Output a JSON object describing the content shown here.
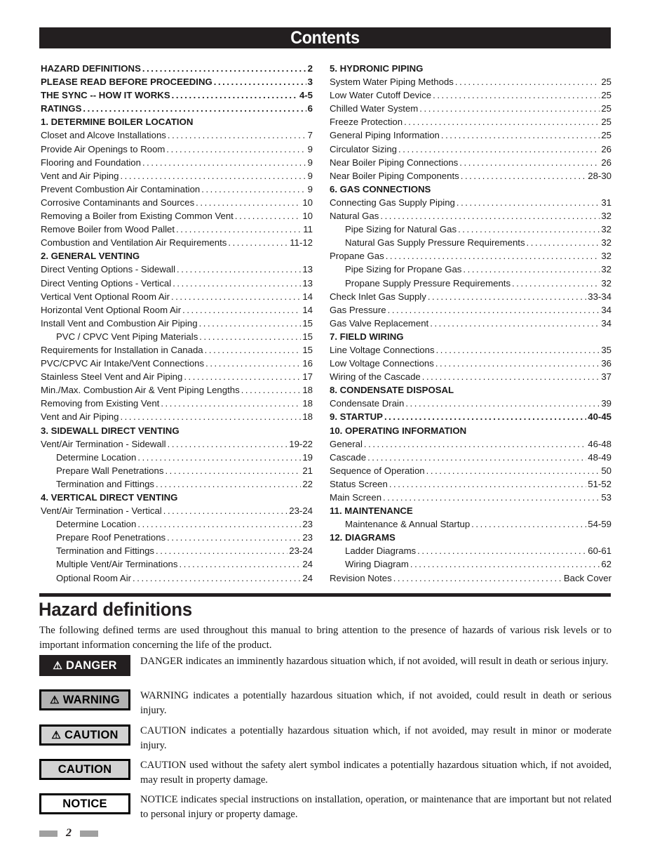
{
  "header": {
    "title": "Contents"
  },
  "toc": {
    "left_column": [
      {
        "label": "HAZARD DEFINITIONS",
        "page": "2",
        "style": "head",
        "indent": 0
      },
      {
        "label": "PLEASE READ BEFORE PROCEEDING",
        "page": "3",
        "style": "head",
        "indent": 0
      },
      {
        "label": "THE SYNC -- HOW IT WORKS",
        "page": "4-5",
        "style": "head",
        "indent": 0
      },
      {
        "label": "RATINGS",
        "page": "6",
        "style": "head",
        "indent": 0
      },
      {
        "label": "1.  DETERMINE BOILER LOCATION",
        "page": "",
        "style": "head",
        "indent": 0
      },
      {
        "label": "Closet and Alcove Installations",
        "page": "7",
        "style": "item",
        "indent": 0
      },
      {
        "label": "Provide Air Openings to Room",
        "page": "9",
        "style": "item",
        "indent": 0
      },
      {
        "label": "Flooring and Foundation",
        "page": "9",
        "style": "item",
        "indent": 0
      },
      {
        "label": "Vent and Air Piping",
        "page": "9",
        "style": "item",
        "indent": 0
      },
      {
        "label": "Prevent Combustion Air Contamination",
        "page": "9",
        "style": "item",
        "indent": 0
      },
      {
        "label": "Corrosive Contaminants and Sources",
        "page": "10",
        "style": "item",
        "indent": 0
      },
      {
        "label": "Removing a Boiler from Existing Common Vent",
        "page": "10",
        "style": "item",
        "indent": 0
      },
      {
        "label": "Remove Boiler from Wood Pallet",
        "page": "11",
        "style": "item",
        "indent": 0
      },
      {
        "label": "Combustion and Ventilation Air Requirements",
        "page": "11-12",
        "style": "item",
        "indent": 0
      },
      {
        "label": "2.  GENERAL VENTING",
        "page": "",
        "style": "head",
        "indent": 0
      },
      {
        "label": "Direct Venting Options - Sidewall",
        "page": "13",
        "style": "item",
        "indent": 0
      },
      {
        "label": "Direct Venting Options - Vertical",
        "page": "13",
        "style": "item",
        "indent": 0
      },
      {
        "label": "Vertical Vent Optional Room Air",
        "page": "14",
        "style": "item",
        "indent": 0
      },
      {
        "label": "Horizontal Vent Optional Room Air",
        "page": "14",
        "style": "item",
        "indent": 0
      },
      {
        "label": "Install Vent and Combustion Air Piping",
        "page": "15",
        "style": "item",
        "indent": 0
      },
      {
        "label": "PVC / CPVC Vent Piping Materials",
        "page": "15",
        "style": "item",
        "indent": 1
      },
      {
        "label": "Requirements for Installation in Canada",
        "page": "15",
        "style": "item",
        "indent": 0
      },
      {
        "label": "PVC/CPVC Air Intake/Vent Connections",
        "page": "16",
        "style": "item",
        "indent": 0
      },
      {
        "label": "Stainless Steel Vent and Air Piping",
        "page": "17",
        "style": "item",
        "indent": 0
      },
      {
        "label": "Min./Max. Combustion Air & Vent Piping Lengths",
        "page": "18",
        "style": "item",
        "indent": 0
      },
      {
        "label": "Removing from Existing Vent",
        "page": "18",
        "style": "item",
        "indent": 0
      },
      {
        "label": "Vent and Air Piping",
        "page": "18",
        "style": "item",
        "indent": 0
      },
      {
        "label": "3.  SIDEWALL DIRECT VENTING",
        "page": "",
        "style": "head",
        "indent": 0
      },
      {
        "label": "Vent/Air Termination - Sidewall",
        "page": "19-22",
        "style": "item",
        "indent": 0
      },
      {
        "label": "Determine Location",
        "page": "19",
        "style": "item",
        "indent": 1
      },
      {
        "label": "Prepare Wall Penetrations",
        "page": "21",
        "style": "item",
        "indent": 1
      },
      {
        "label": "Termination and Fittings",
        "page": "22",
        "style": "item",
        "indent": 1
      },
      {
        "label": "4.  VERTICAL DIRECT VENTING",
        "page": "",
        "style": "head",
        "indent": 0
      },
      {
        "label": "Vent/Air Termination - Vertical",
        "page": "23-24",
        "style": "item",
        "indent": 0
      },
      {
        "label": "Determine Location",
        "page": "23",
        "style": "item",
        "indent": 1
      },
      {
        "label": "Prepare Roof Penetrations",
        "page": "23",
        "style": "item",
        "indent": 1
      },
      {
        "label": "Termination and Fittings",
        "page": "23-24",
        "style": "item",
        "indent": 1
      },
      {
        "label": "Multiple Vent/Air Terminations",
        "page": "24",
        "style": "item",
        "indent": 1
      },
      {
        "label": "Optional Room Air",
        "page": "24",
        "style": "item",
        "indent": 1
      }
    ],
    "right_column": [
      {
        "label": "5.  HYDRONIC PIPING",
        "page": "",
        "style": "head",
        "indent": 0
      },
      {
        "label": "System Water Piping Methods",
        "page": "25",
        "style": "item",
        "indent": 0
      },
      {
        "label": "Low Water Cutoff Device",
        "page": "25",
        "style": "item",
        "indent": 0
      },
      {
        "label": "Chilled Water System",
        "page": "25",
        "style": "item",
        "indent": 0
      },
      {
        "label": "Freeze Protection",
        "page": "25",
        "style": "item",
        "indent": 0
      },
      {
        "label": "General Piping Information",
        "page": "25",
        "style": "item",
        "indent": 0
      },
      {
        "label": "Circulator Sizing",
        "page": "26",
        "style": "item",
        "indent": 0
      },
      {
        "label": "Near Boiler Piping Connections",
        "page": "26",
        "style": "item",
        "indent": 0
      },
      {
        "label": "Near Boiler Piping Components",
        "page": "28-30",
        "style": "item",
        "indent": 0
      },
      {
        "label": "6.  GAS CONNECTIONS",
        "page": "",
        "style": "head",
        "indent": 0
      },
      {
        "label": "Connecting Gas Supply Piping",
        "page": "31",
        "style": "item",
        "indent": 0
      },
      {
        "label": "Natural Gas",
        "page": "32",
        "style": "item",
        "indent": 0
      },
      {
        "label": "Pipe Sizing for Natural Gas",
        "page": "32",
        "style": "item",
        "indent": 1
      },
      {
        "label": "Natural Gas Supply Pressure Requirements",
        "page": "32",
        "style": "item",
        "indent": 1
      },
      {
        "label": "Propane Gas",
        "page": "32",
        "style": "item",
        "indent": 0
      },
      {
        "label": "Pipe Sizing for Propane Gas",
        "page": "32",
        "style": "item",
        "indent": 1
      },
      {
        "label": "Propane Supply Pressure Requirements",
        "page": "32",
        "style": "item",
        "indent": 1
      },
      {
        "label": "Check Inlet Gas Supply",
        "page": "33-34",
        "style": "item",
        "indent": 0
      },
      {
        "label": "Gas Pressure",
        "page": "34",
        "style": "item",
        "indent": 0
      },
      {
        "label": "Gas Valve Replacement",
        "page": "34",
        "style": "item",
        "indent": 0
      },
      {
        "label": "7.  FIELD WIRING",
        "page": "",
        "style": "head",
        "indent": 0
      },
      {
        "label": "Line Voltage Connections",
        "page": "35",
        "style": "item",
        "indent": 0
      },
      {
        "label": "Low Voltage Connections",
        "page": "36",
        "style": "item",
        "indent": 0
      },
      {
        "label": "Wiring of the Cascade",
        "page": "37",
        "style": "item",
        "indent": 0
      },
      {
        "label": "8.  CONDENSATE DISPOSAL",
        "page": "",
        "style": "head",
        "indent": 0
      },
      {
        "label": "Condensate Drain",
        "page": "39",
        "style": "item",
        "indent": 0
      },
      {
        "label": "9. STARTUP",
        "page": "40-45",
        "style": "head",
        "indent": 0
      },
      {
        "label": "10. OPERATING INFORMATION",
        "page": "",
        "style": "head",
        "indent": 0
      },
      {
        "label": "General",
        "page": "46-48",
        "style": "item",
        "indent": 0
      },
      {
        "label": "Cascade",
        "page": "48-49",
        "style": "item",
        "indent": 0
      },
      {
        "label": "Sequence of Operation",
        "page": "50",
        "style": "item",
        "indent": 0
      },
      {
        "label": "Status Screen",
        "page": "51-52",
        "style": "item",
        "indent": 0
      },
      {
        "label": "Main Screen",
        "page": "53",
        "style": "item",
        "indent": 0
      },
      {
        "label": "11. MAINTENANCE",
        "page": "",
        "style": "head",
        "indent": 0
      },
      {
        "label": "Maintenance & Annual Startup",
        "page": "54-59",
        "style": "item",
        "indent": 1
      },
      {
        "label": "12. DIAGRAMS",
        "page": "",
        "style": "head",
        "indent": 0
      },
      {
        "label": "Ladder Diagrams",
        "page": "60-61",
        "style": "item",
        "indent": 1
      },
      {
        "label": "Wiring Diagram",
        "page": "62",
        "style": "item",
        "indent": 1
      },
      {
        "label": "Revision Notes",
        "page": "Back Cover",
        "style": "item",
        "indent": 0
      }
    ]
  },
  "hazard": {
    "title": "Hazard definitions",
    "intro": "The following defined terms are used throughout this manual to bring attention to the presence of hazards of various risk levels or to important information concerning the life of the product.",
    "items": [
      {
        "label": "DANGER",
        "symbol": "⚠",
        "has_symbol": true,
        "box_style": "danger",
        "bg": "#231f20",
        "fg": "#ffffff",
        "text": "DANGER indicates an imminently hazardous situation which, if not avoided, will result in death or serious injury."
      },
      {
        "label": "WARNING",
        "symbol": "⚠",
        "has_symbol": true,
        "box_style": "warning",
        "bg": "#b2b2b2",
        "fg": "#000000",
        "text": "WARNING indicates a potentially hazardous situation which, if not avoided, could result in death or serious injury."
      },
      {
        "label": "CAUTION",
        "symbol": "⚠",
        "has_symbol": true,
        "box_style": "caution",
        "bg": "#d2d2d2",
        "fg": "#000000",
        "text": "CAUTION indicates a potentially hazardous situation which, if not avoided, may result in minor or moderate injury."
      },
      {
        "label": "CAUTION",
        "symbol": "",
        "has_symbol": false,
        "box_style": "caution-plain",
        "bg": "#d2d2d2",
        "fg": "#000000",
        "text": "CAUTION used without the safety alert symbol indicates a potentially hazardous situation which, if not avoided, may result in property damage."
      },
      {
        "label": "NOTICE",
        "symbol": "",
        "has_symbol": false,
        "box_style": "notice",
        "bg": "#ffffff",
        "fg": "#000000",
        "text": "NOTICE indicates special instructions on installation, operation, or maintenance that are important but not related to personal injury or property damage."
      }
    ]
  },
  "footer": {
    "page_number": "2"
  }
}
